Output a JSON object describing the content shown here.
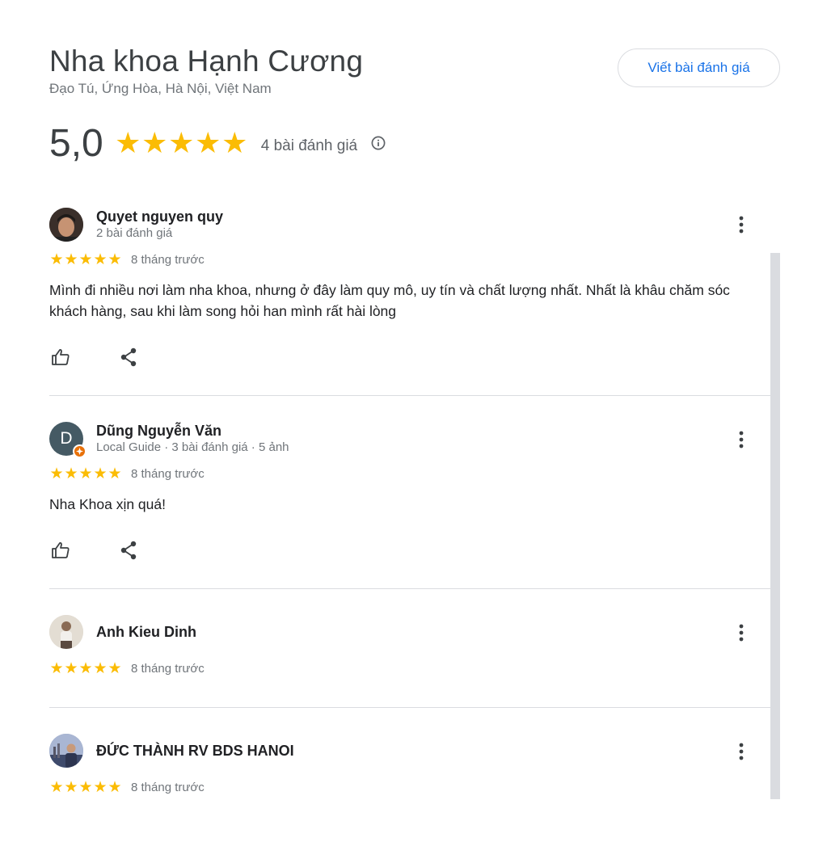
{
  "place": {
    "name": "Nha khoa Hạnh Cương",
    "address": "Đạo Tú, Ứng Hòa, Hà Nội, Việt Nam"
  },
  "write_review_label": "Viết bài đánh giá",
  "summary": {
    "score": "5,0",
    "stars": 5,
    "count_label": "4 bài đánh giá"
  },
  "colors": {
    "star": "#fbbc04",
    "accent": "#1a73e8",
    "local_guide_badge": "#e8710a"
  },
  "reviews": [
    {
      "name": "Quyet nguyen quy",
      "meta": "2 bài đánh giá",
      "rating": 5,
      "time": "8 tháng trước",
      "text": "Mình đi nhiều nơi làm nha khoa, nhưng ở đây làm quy mô, uy tín và chất lượng nhất. Nhất là khâu chăm sóc khách hàng, sau khi làm song hỏi han mình rất hài lòng",
      "avatar_icon": "user-photo-icon"
    },
    {
      "name": "Dũng Nguyễn Văn",
      "meta": "Local Guide · 3 bài đánh giá · 5 ảnh",
      "rating": 5,
      "time": "8 tháng trước",
      "text": "Nha Khoa xịn quá!",
      "avatar_letter": "D",
      "avatar_icon": "letter-avatar-icon"
    },
    {
      "name": "Anh Kieu Dinh",
      "meta": "",
      "rating": 5,
      "time": "8 tháng trước",
      "text": "",
      "avatar_icon": "user-photo-icon"
    },
    {
      "name": "ĐỨC THÀNH RV BDS HANOI",
      "meta": "",
      "rating": 5,
      "time": "8 tháng trước",
      "text": "",
      "avatar_icon": "user-photo-icon"
    }
  ]
}
